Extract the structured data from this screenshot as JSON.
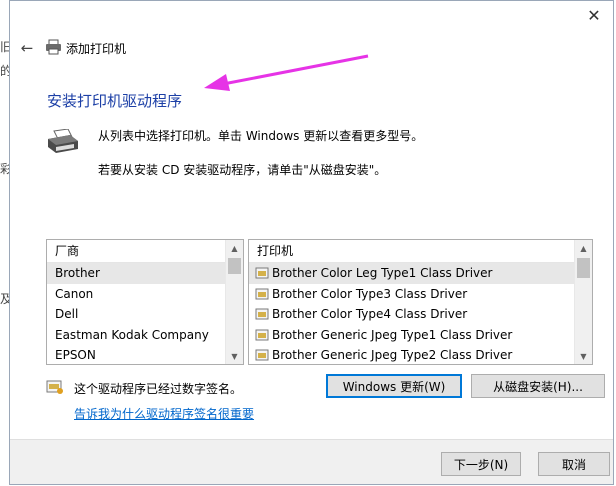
{
  "window": {
    "title": "添加打印机",
    "close_glyph": "✕",
    "back_glyph": "←"
  },
  "heading": "安装打印机驱动程序",
  "description": {
    "line1": "从列表中选择打印机。单击 Windows 更新以查看更多型号。",
    "line2": "若要从安装 CD 安装驱动程序，请单击\"从磁盘安装\"。"
  },
  "manufacturers": {
    "header": "厂商",
    "items": [
      "Brother",
      "Canon",
      "Dell",
      "Eastman Kodak Company",
      "EPSON"
    ],
    "selected_index": 0
  },
  "printers": {
    "header": "打印机",
    "items": [
      "Brother Color Leg Type1 Class Driver",
      "Brother Color Type3 Class Driver",
      "Brother Color Type4 Class Driver",
      "Brother Generic Jpeg Type1 Class Driver",
      "Brother Generic Jpeg Type2 Class Driver"
    ],
    "selected_index": 0
  },
  "signature": {
    "status": "这个驱动程序已经过数字签名。",
    "link": "告诉我为什么驱动程序签名很重要"
  },
  "buttons": {
    "windows_update": "Windows 更新(W)",
    "from_disk": "从磁盘安装(H)...",
    "next": "下一步(N)",
    "cancel": "取消"
  },
  "background_glyphs": [
    "旧",
    "的",
    "彩",
    "及"
  ],
  "colors": {
    "heading": "#1c3fa6",
    "link": "#0066cc",
    "arrow": "#e633e6",
    "focus": "#0078d7"
  }
}
